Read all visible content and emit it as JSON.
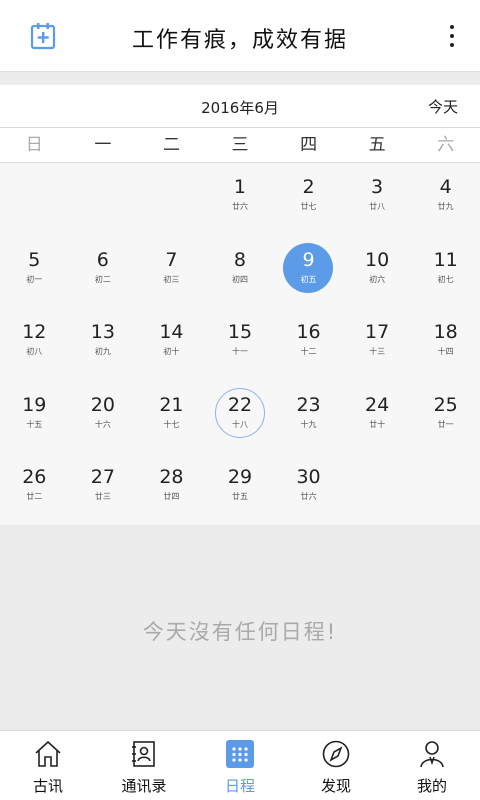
{
  "header": {
    "title": "工作有痕，成效有据"
  },
  "calendar": {
    "month_label": "2016年6月",
    "today_label": "今天",
    "weekdays": [
      "日",
      "一",
      "二",
      "三",
      "四",
      "五",
      "六"
    ],
    "days": [
      {
        "n": "",
        "l": ""
      },
      {
        "n": "",
        "l": ""
      },
      {
        "n": "",
        "l": ""
      },
      {
        "n": "1",
        "l": "廿六"
      },
      {
        "n": "2",
        "l": "廿七"
      },
      {
        "n": "3",
        "l": "廿八"
      },
      {
        "n": "4",
        "l": "廿九"
      },
      {
        "n": "5",
        "l": "初一"
      },
      {
        "n": "6",
        "l": "初二"
      },
      {
        "n": "7",
        "l": "初三"
      },
      {
        "n": "8",
        "l": "初四"
      },
      {
        "n": "9",
        "l": "初五",
        "state": "selected"
      },
      {
        "n": "10",
        "l": "初六"
      },
      {
        "n": "11",
        "l": "初七"
      },
      {
        "n": "12",
        "l": "初八"
      },
      {
        "n": "13",
        "l": "初九"
      },
      {
        "n": "14",
        "l": "初十"
      },
      {
        "n": "15",
        "l": "十一"
      },
      {
        "n": "16",
        "l": "十二"
      },
      {
        "n": "17",
        "l": "十三"
      },
      {
        "n": "18",
        "l": "十四"
      },
      {
        "n": "19",
        "l": "十五"
      },
      {
        "n": "20",
        "l": "十六"
      },
      {
        "n": "21",
        "l": "十七"
      },
      {
        "n": "22",
        "l": "十八",
        "state": "today"
      },
      {
        "n": "23",
        "l": "十九"
      },
      {
        "n": "24",
        "l": "廿十"
      },
      {
        "n": "25",
        "l": "廿一"
      },
      {
        "n": "26",
        "l": "廿二"
      },
      {
        "n": "27",
        "l": "廿三"
      },
      {
        "n": "28",
        "l": "廿四"
      },
      {
        "n": "29",
        "l": "廿五"
      },
      {
        "n": "30",
        "l": "廿六"
      }
    ]
  },
  "empty_message": "今天沒有任何日程!",
  "tabs": [
    {
      "label": "古讯",
      "icon": "home-icon"
    },
    {
      "label": "通讯录",
      "icon": "contacts-icon"
    },
    {
      "label": "日程",
      "icon": "calendar-grid-icon",
      "active": true
    },
    {
      "label": "发现",
      "icon": "compass-icon"
    },
    {
      "label": "我的",
      "icon": "person-icon"
    }
  ],
  "colors": {
    "accent": "#5b9be8",
    "today_ring": "#8ab6ee",
    "weekend": "#aaaaaa"
  }
}
